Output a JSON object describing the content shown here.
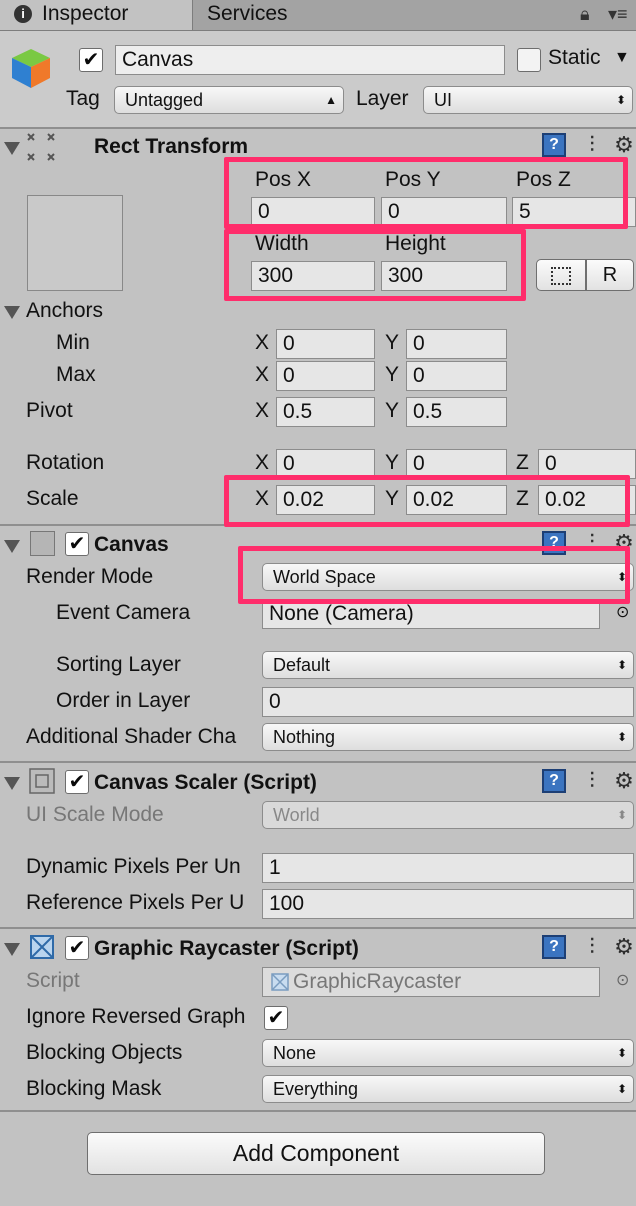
{
  "tabs": {
    "inspector": "Inspector",
    "services": "Services"
  },
  "header": {
    "object_name": "Canvas",
    "static_label": "Static",
    "tag_label": "Tag",
    "tag_value": "Untagged",
    "layer_label": "Layer",
    "layer_value": "UI"
  },
  "rect_transform": {
    "title": "Rect Transform",
    "pos_x_label": "Pos X",
    "pos_y_label": "Pos Y",
    "pos_z_label": "Pos Z",
    "pos_x": "0",
    "pos_y": "0",
    "pos_z": "5",
    "width_label": "Width",
    "height_label": "Height",
    "width": "300",
    "height": "300",
    "raw_button": "R",
    "anchors_label": "Anchors",
    "min_label": "Min",
    "max_label": "Max",
    "x_label": "X",
    "y_label": "Y",
    "z_label": "Z",
    "anchor_min_x": "0",
    "anchor_min_y": "0",
    "anchor_max_x": "0",
    "anchor_max_y": "0",
    "pivot_label": "Pivot",
    "pivot_x": "0.5",
    "pivot_y": "0.5",
    "rotation_label": "Rotation",
    "rotation_x": "0",
    "rotation_y": "0",
    "rotation_z": "0",
    "scale_label": "Scale",
    "scale_x": "0.02",
    "scale_y": "0.02",
    "scale_z": "0.02"
  },
  "canvas": {
    "title": "Canvas",
    "render_mode_label": "Render Mode",
    "render_mode": "World Space",
    "event_camera_label": "Event Camera",
    "event_camera": "None (Camera)",
    "sorting_layer_label": "Sorting Layer",
    "sorting_layer": "Default",
    "order_label": "Order in Layer",
    "order": "0",
    "shader_label": "Additional Shader Cha",
    "shader": "Nothing"
  },
  "canvas_scaler": {
    "title": "Canvas Scaler (Script)",
    "ui_scale_mode_label": "UI Scale Mode",
    "ui_scale_mode": "World",
    "dynamic_label": "Dynamic Pixels Per Un",
    "dynamic": "1",
    "reference_label": "Reference Pixels Per U",
    "reference": "100"
  },
  "graphic_raycaster": {
    "title": "Graphic Raycaster (Script)",
    "script_label": "Script",
    "script": "GraphicRaycaster",
    "ignore_label": "Ignore Reversed Graph",
    "blocking_objects_label": "Blocking Objects",
    "blocking_objects": "None",
    "blocking_mask_label": "Blocking Mask",
    "blocking_mask": "Everything"
  },
  "add_component": "Add Component",
  "colors": {
    "highlight": "#ff2d6b",
    "panel": "#c2c2c2",
    "help_icon": "#3b74c0"
  }
}
